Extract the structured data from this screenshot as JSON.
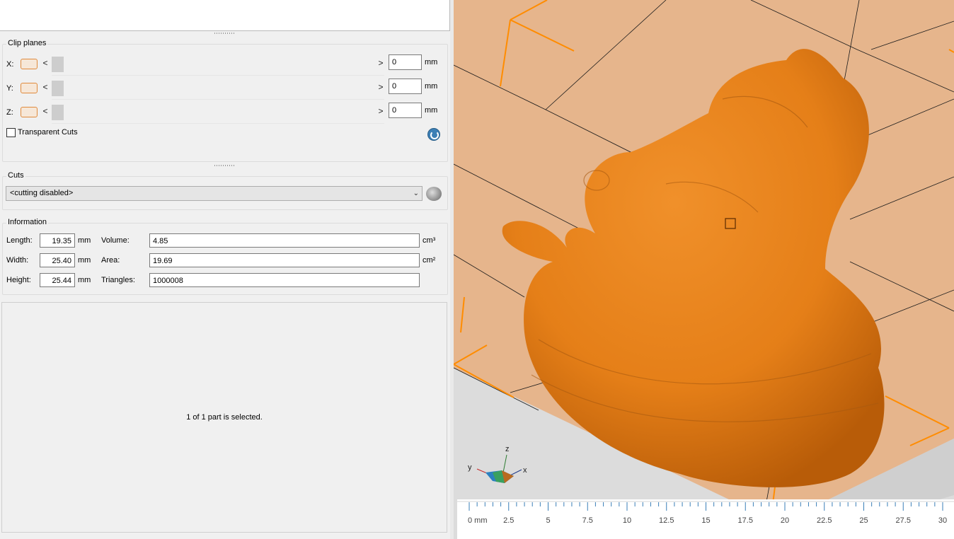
{
  "clip_planes": {
    "title": "Clip planes",
    "rows": [
      {
        "axis": "X:",
        "value": "0",
        "unit": "mm"
      },
      {
        "axis": "Y:",
        "value": "0",
        "unit": "mm"
      },
      {
        "axis": "Z:",
        "value": "0",
        "unit": "mm"
      }
    ],
    "left_arrow": "<",
    "right_arrow": ">",
    "transparent_cuts_label": "Transparent Cuts",
    "transparent_cuts_checked": false
  },
  "cuts": {
    "title": "Cuts",
    "selected": "<cutting disabled>"
  },
  "information": {
    "title": "Information",
    "length_label": "Length:",
    "length_value": "19.35",
    "length_unit": "mm",
    "width_label": "Width:",
    "width_value": "25.40",
    "width_unit": "mm",
    "height_label": "Height:",
    "height_value": "25.44",
    "height_unit": "mm",
    "volume_label": "Volume:",
    "volume_value": "4.85",
    "volume_unit": "cm³",
    "area_label": "Area:",
    "area_value": "19.69",
    "area_unit": "cm²",
    "triangles_label": "Triangles:",
    "triangles_value": "1000008"
  },
  "selection_status": "1 of 1 part is selected.",
  "viewport": {
    "axis_labels": {
      "z": "z",
      "y": "y",
      "x": "x"
    },
    "ruler_labels": [
      "0 mm",
      "2.5",
      "5",
      "7.5",
      "10",
      "12.5",
      "15",
      "17.5",
      "20",
      "22.5",
      "25",
      "27.5",
      "30"
    ],
    "colors": {
      "model": "#e8801a",
      "bed": "#e6b58c",
      "accent": "#ff8c00"
    }
  }
}
